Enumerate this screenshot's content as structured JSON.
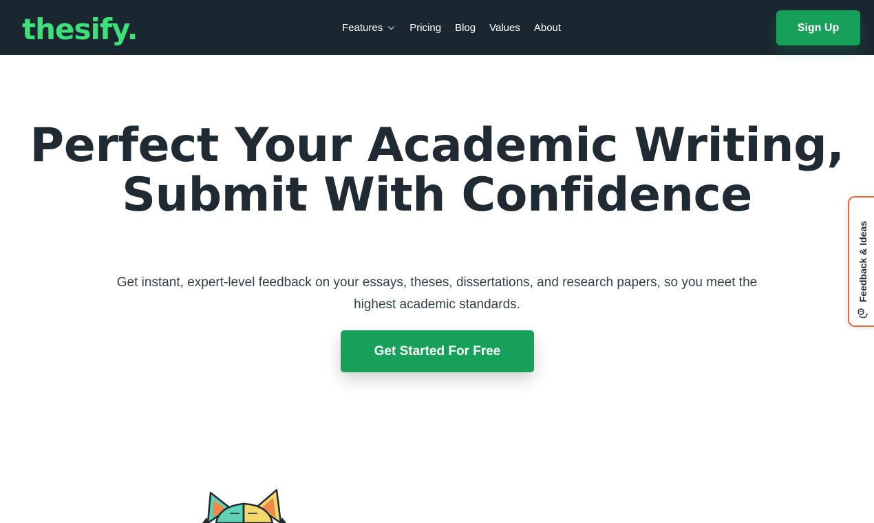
{
  "brand": {
    "logo_text": "thesify."
  },
  "nav": {
    "items": [
      {
        "label": "Features",
        "has_dropdown": true
      },
      {
        "label": "Pricing"
      },
      {
        "label": "Blog"
      },
      {
        "label": "Values"
      },
      {
        "label": "About"
      }
    ],
    "signup_label": "Sign Up"
  },
  "hero": {
    "title_line1": "Perfect Your Academic Writing,",
    "title_line2": "Submit With Confidence",
    "subtitle": "Get instant, expert-level feedback on your essays, theses, dissertations, and research papers, so you meet the highest academic standards.",
    "cta_label": "Get Started For Free"
  },
  "feedback_tab": {
    "label": "Feedback & Ideas",
    "icon": "feedback-face-icon"
  },
  "mascot": {
    "icon": "cat-mascot-icon"
  },
  "colors": {
    "nav_bg": "#1a2630",
    "brand_green": "#3ee07a",
    "button_green": "#17a05a",
    "heading": "#1f2a33",
    "feedback_border": "#e9663b"
  }
}
